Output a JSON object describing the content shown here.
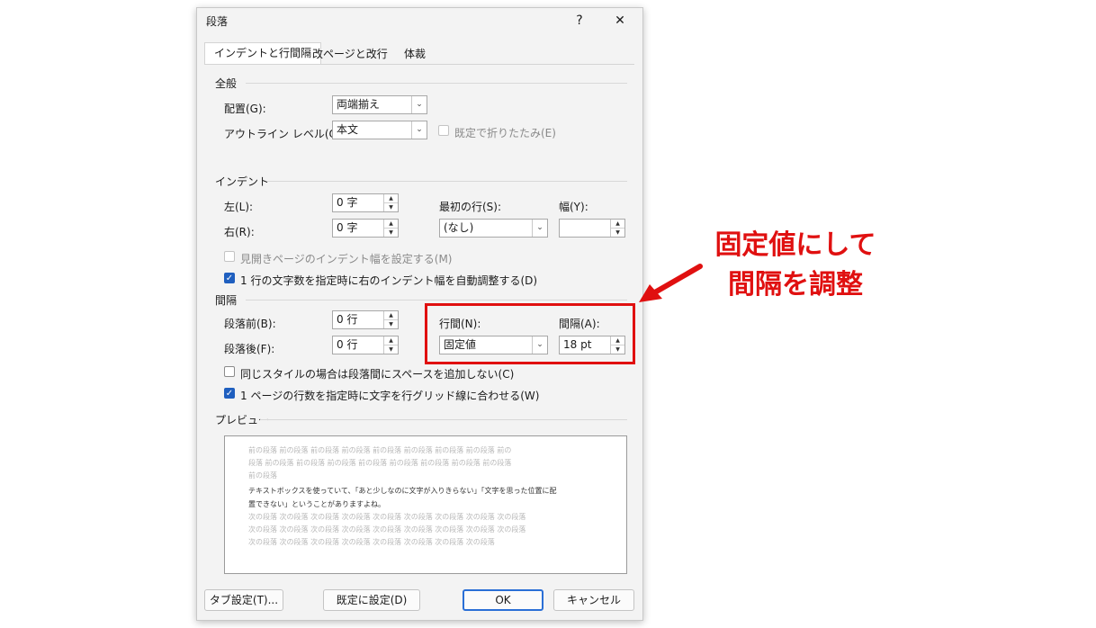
{
  "dialog": {
    "title": "段落",
    "help_label": "?",
    "close_label": "✕",
    "tabs": [
      "インデントと行間隔",
      "改ページと改行",
      "体裁"
    ]
  },
  "general": {
    "heading": "全般",
    "alignment_label": "配置(G):",
    "alignment_value": "両端揃え",
    "outline_label": "アウトライン レベル(O):",
    "outline_value": "本文",
    "collapse_label": "既定で折りたたみ(E)"
  },
  "indent": {
    "heading": "インデント",
    "left_label": "左(L):",
    "left_value": "0 字",
    "right_label": "右(R):",
    "right_value": "0 字",
    "first_line_label": "最初の行(S):",
    "first_line_value": "(なし)",
    "width_label": "幅(Y):",
    "width_value": "",
    "mirror_label": "見開きページのインデント幅を設定する(M)",
    "auto_adjust_label": "1 行の文字数を指定時に右のインデント幅を自動調整する(D)"
  },
  "spacing": {
    "heading": "間隔",
    "before_label": "段落前(B):",
    "before_value": "0 行",
    "after_label": "段落後(F):",
    "after_value": "0 行",
    "line_spacing_label": "行間(N):",
    "line_spacing_value": "固定値",
    "at_label": "間隔(A):",
    "at_value": "18 pt",
    "no_space_label": "同じスタイルの場合は段落間にスペースを追加しない(C)",
    "snap_grid_label": "1 ページの行数を指定時に文字を行グリッド線に合わせる(W)"
  },
  "preview": {
    "heading": "プレビュー",
    "prev_lines": [
      "前の段落 前の段落 前の段落 前の段落 前の段落 前の段落 前の段落 前の段落 前の",
      "段落 前の段落 前の段落 前の段落 前の段落 前の段落 前の段落 前の段落 前の段落",
      "前の段落"
    ],
    "sample_lines": [
      "テキストボックスを使っていて、「あと少しなのに文字が入りきらない」「文字を思った位置に配",
      "置できない」ということがありますよね。"
    ],
    "next_lines": [
      "次の段落 次の段落 次の段落 次の段落 次の段落 次の段落 次の段落 次の段落 次の段落",
      "次の段落 次の段落 次の段落 次の段落 次の段落 次の段落 次の段落 次の段落 次の段落",
      "次の段落 次の段落 次の段落 次の段落 次の段落 次の段落 次の段落 次の段落"
    ]
  },
  "buttons": {
    "tabs_label": "タブ設定(T)...",
    "default_label": "既定に設定(D)",
    "ok_label": "OK",
    "cancel_label": "キャンセル"
  },
  "annotation": {
    "line1": "固定値にして",
    "line2": "間隔を調整"
  },
  "colors": {
    "annotation_red": "#e01010",
    "checkbox_blue": "#1f5fbf"
  }
}
